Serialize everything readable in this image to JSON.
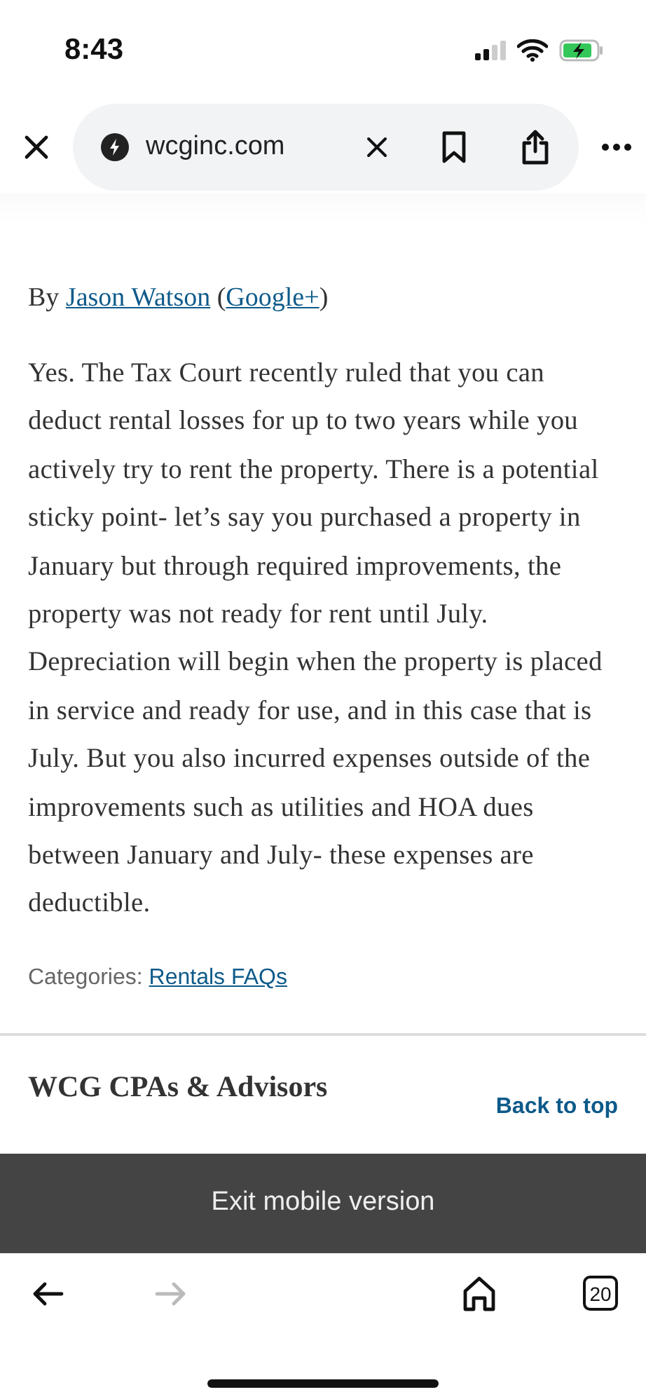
{
  "status_bar": {
    "time": "8:43"
  },
  "browser_bar": {
    "url": "wcginc.com"
  },
  "article": {
    "byline_prefix": "By",
    "author": "Jason Watson",
    "open_paren": "(",
    "social_link": "Google+",
    "close_paren": ")",
    "body": "Yes. The Tax Court recently ruled that you can deduct rental losses for up to two years while you actively try to rent the property. There is a potential sticky point- let’s say you purchased a property in January but through required improvements, the property was not ready for rent until July. Depreciation will begin when the property is placed in service and ready for use, and in this case that is July. But you also incurred expenses outside of the improvements such as utilities and HOA dues between January and July- these expenses are deductible.",
    "categories_label": "Categories:",
    "category": "Rentals FAQs"
  },
  "footer": {
    "site_name": "WCG CPAs & Advisors",
    "back_to_top": "Back to top"
  },
  "mobile_bar": {
    "label": "Exit mobile version"
  },
  "toolbar": {
    "back_disabled": false,
    "forward_disabled": true,
    "tab_count": "20"
  }
}
